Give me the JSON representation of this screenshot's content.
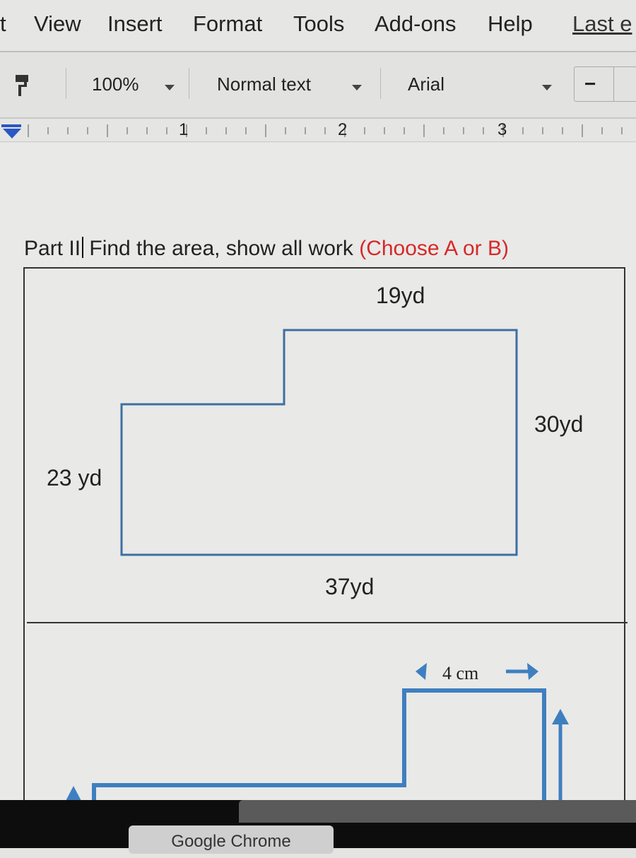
{
  "menubar": {
    "items": [
      "t",
      "View",
      "Insert",
      "Format",
      "Tools",
      "Add-ons",
      "Help"
    ],
    "last_edit": "Last e"
  },
  "toolbar": {
    "zoom": "100%",
    "style": "Normal text",
    "font": "Arial",
    "font_size_minus": "−"
  },
  "ruler": {
    "numbers": [
      "1",
      "2",
      "3"
    ]
  },
  "document": {
    "heading_part": "Part II",
    "heading_text": " Find the area, show all work ",
    "heading_choice": "(Choose A or B)",
    "heading_choice_color": "#d42a2a",
    "figure_a": {
      "top": "19yd",
      "right": "30yd",
      "left": "23 yd",
      "bottom": "37yd",
      "stroke_color": "#3d6fa3"
    },
    "figure_b": {
      "top": "4 cm",
      "stroke_color": "#3f7fc0"
    }
  },
  "taskbar": {
    "app": "Google Chrome"
  }
}
